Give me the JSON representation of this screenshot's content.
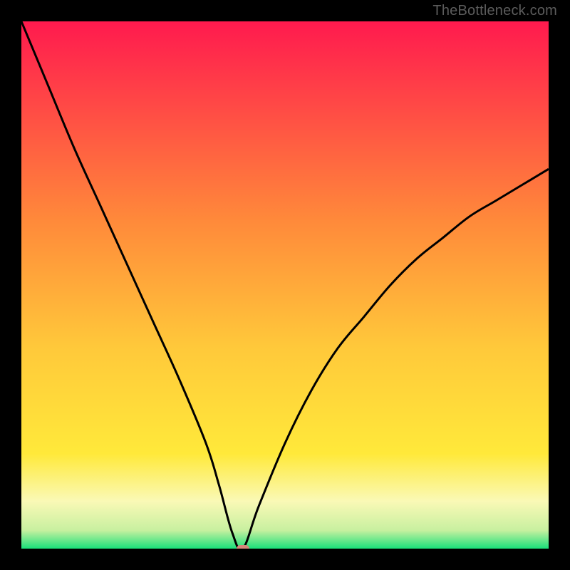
{
  "watermark": "TheBottleneck.com",
  "colors": {
    "top": "#ff1a4e",
    "mid_orange": "#ffa23a",
    "yellow": "#ffe93a",
    "pale_yellow": "#faf9b6",
    "green": "#19e07a",
    "marker": "#d6877a",
    "frame": "#000000"
  },
  "chart_data": {
    "type": "line",
    "title": "",
    "xlabel": "",
    "ylabel": "",
    "xlim": [
      0,
      100
    ],
    "ylim": [
      0,
      100
    ],
    "x": [
      0,
      5,
      10,
      15,
      20,
      25,
      30,
      35,
      37.5,
      40,
      42,
      45,
      50,
      55,
      60,
      65,
      70,
      75,
      80,
      85,
      90,
      95,
      100
    ],
    "values": [
      100,
      88,
      76,
      65,
      54,
      43,
      32,
      20,
      12,
      3,
      0,
      8,
      20,
      30,
      38,
      44,
      50,
      55,
      59,
      63,
      66,
      69,
      72
    ],
    "minimum_marker": {
      "x": 42,
      "y": 0
    },
    "annotations": []
  }
}
